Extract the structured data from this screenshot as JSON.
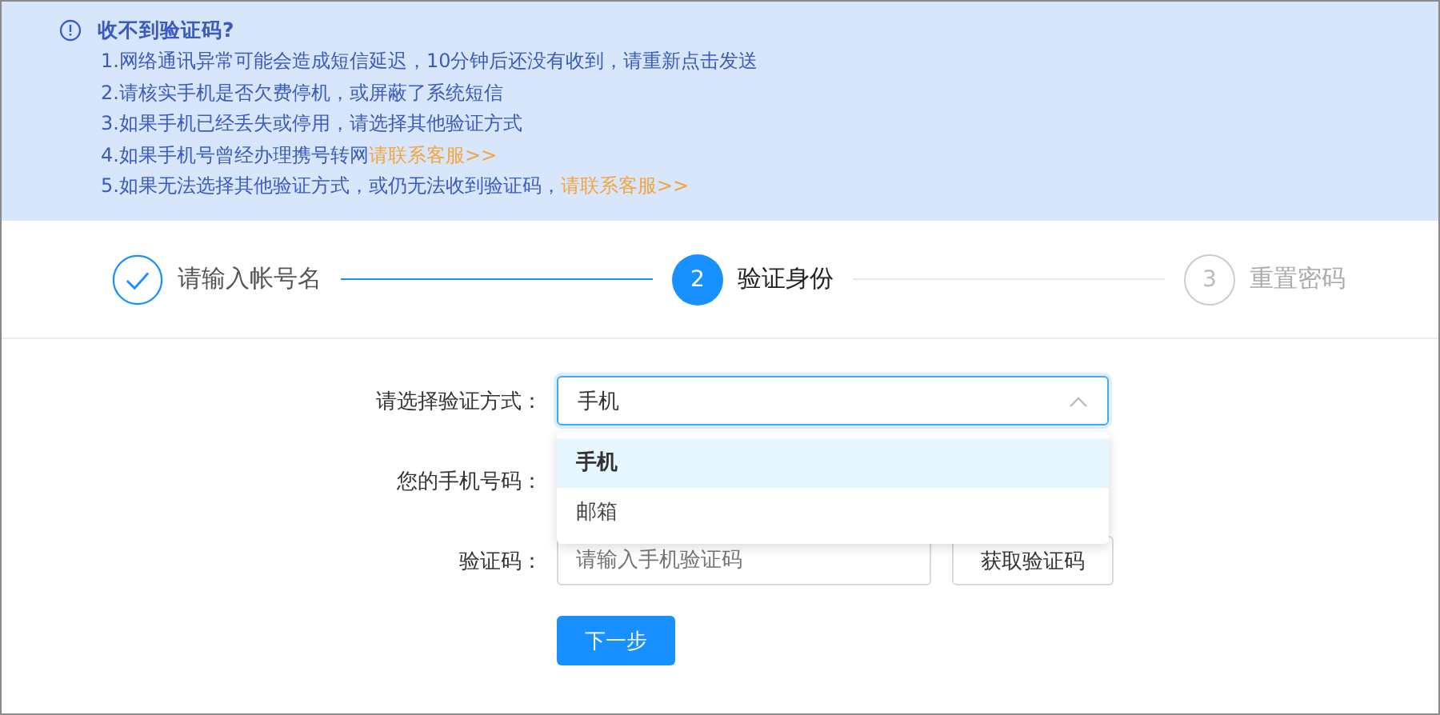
{
  "notice": {
    "title": "收不到验证码?",
    "lines": [
      {
        "text": "1.网络通讯异常可能会造成短信延迟，10分钟后还没有收到，请重新点击发送"
      },
      {
        "text": "2.请核实手机是否欠费停机，或屏蔽了系统短信"
      },
      {
        "text": "3.如果手机已经丢失或停用，请选择其他验证方式"
      },
      {
        "text": "4.如果手机号曾经办理携号转网",
        "link": "请联系客服>>"
      },
      {
        "text": "5.如果无法选择其他验证方式，或仍无法收到验证码，",
        "link": "请联系客服>>"
      }
    ]
  },
  "steps": [
    {
      "label": "请输入帐号名",
      "finished": true,
      "selected": false
    },
    {
      "number": "2",
      "label": "验证身份",
      "finished": false,
      "selected": true
    },
    {
      "number": "3",
      "label": "重置密码",
      "finished": false,
      "selected": false
    }
  ],
  "form": {
    "method": {
      "label": "请选择验证方式：",
      "value": "手机",
      "expanded": true,
      "options": [
        {
          "label": "手机",
          "selected": true
        },
        {
          "label": "邮箱",
          "selected": false
        }
      ]
    },
    "phone": {
      "label": "您的手机号码："
    },
    "code": {
      "label": "验证码：",
      "placeholder": "请输入手机验证码",
      "button": "获取验证码"
    },
    "submit": "下一步"
  }
}
